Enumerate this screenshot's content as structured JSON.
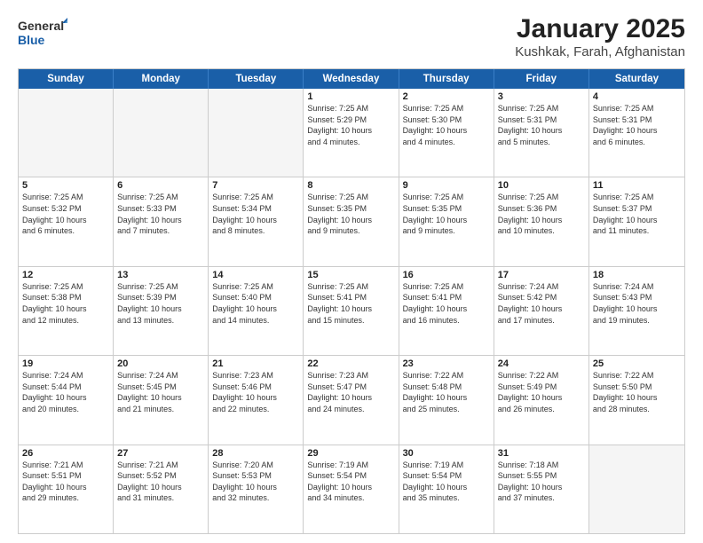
{
  "logo": {
    "general": "General",
    "blue": "Blue"
  },
  "title": "January 2025",
  "subtitle": "Kushkak, Farah, Afghanistan",
  "header_days": [
    "Sunday",
    "Monday",
    "Tuesday",
    "Wednesday",
    "Thursday",
    "Friday",
    "Saturday"
  ],
  "weeks": [
    [
      {
        "day": "",
        "info": "",
        "empty": true
      },
      {
        "day": "",
        "info": "",
        "empty": true
      },
      {
        "day": "",
        "info": "",
        "empty": true
      },
      {
        "day": "1",
        "info": "Sunrise: 7:25 AM\nSunset: 5:29 PM\nDaylight: 10 hours\nand 4 minutes.",
        "empty": false
      },
      {
        "day": "2",
        "info": "Sunrise: 7:25 AM\nSunset: 5:30 PM\nDaylight: 10 hours\nand 4 minutes.",
        "empty": false
      },
      {
        "day": "3",
        "info": "Sunrise: 7:25 AM\nSunset: 5:31 PM\nDaylight: 10 hours\nand 5 minutes.",
        "empty": false
      },
      {
        "day": "4",
        "info": "Sunrise: 7:25 AM\nSunset: 5:31 PM\nDaylight: 10 hours\nand 6 minutes.",
        "empty": false
      }
    ],
    [
      {
        "day": "5",
        "info": "Sunrise: 7:25 AM\nSunset: 5:32 PM\nDaylight: 10 hours\nand 6 minutes.",
        "empty": false
      },
      {
        "day": "6",
        "info": "Sunrise: 7:25 AM\nSunset: 5:33 PM\nDaylight: 10 hours\nand 7 minutes.",
        "empty": false
      },
      {
        "day": "7",
        "info": "Sunrise: 7:25 AM\nSunset: 5:34 PM\nDaylight: 10 hours\nand 8 minutes.",
        "empty": false
      },
      {
        "day": "8",
        "info": "Sunrise: 7:25 AM\nSunset: 5:35 PM\nDaylight: 10 hours\nand 9 minutes.",
        "empty": false
      },
      {
        "day": "9",
        "info": "Sunrise: 7:25 AM\nSunset: 5:35 PM\nDaylight: 10 hours\nand 9 minutes.",
        "empty": false
      },
      {
        "day": "10",
        "info": "Sunrise: 7:25 AM\nSunset: 5:36 PM\nDaylight: 10 hours\nand 10 minutes.",
        "empty": false
      },
      {
        "day": "11",
        "info": "Sunrise: 7:25 AM\nSunset: 5:37 PM\nDaylight: 10 hours\nand 11 minutes.",
        "empty": false
      }
    ],
    [
      {
        "day": "12",
        "info": "Sunrise: 7:25 AM\nSunset: 5:38 PM\nDaylight: 10 hours\nand 12 minutes.",
        "empty": false
      },
      {
        "day": "13",
        "info": "Sunrise: 7:25 AM\nSunset: 5:39 PM\nDaylight: 10 hours\nand 13 minutes.",
        "empty": false
      },
      {
        "day": "14",
        "info": "Sunrise: 7:25 AM\nSunset: 5:40 PM\nDaylight: 10 hours\nand 14 minutes.",
        "empty": false
      },
      {
        "day": "15",
        "info": "Sunrise: 7:25 AM\nSunset: 5:41 PM\nDaylight: 10 hours\nand 15 minutes.",
        "empty": false
      },
      {
        "day": "16",
        "info": "Sunrise: 7:25 AM\nSunset: 5:41 PM\nDaylight: 10 hours\nand 16 minutes.",
        "empty": false
      },
      {
        "day": "17",
        "info": "Sunrise: 7:24 AM\nSunset: 5:42 PM\nDaylight: 10 hours\nand 17 minutes.",
        "empty": false
      },
      {
        "day": "18",
        "info": "Sunrise: 7:24 AM\nSunset: 5:43 PM\nDaylight: 10 hours\nand 19 minutes.",
        "empty": false
      }
    ],
    [
      {
        "day": "19",
        "info": "Sunrise: 7:24 AM\nSunset: 5:44 PM\nDaylight: 10 hours\nand 20 minutes.",
        "empty": false
      },
      {
        "day": "20",
        "info": "Sunrise: 7:24 AM\nSunset: 5:45 PM\nDaylight: 10 hours\nand 21 minutes.",
        "empty": false
      },
      {
        "day": "21",
        "info": "Sunrise: 7:23 AM\nSunset: 5:46 PM\nDaylight: 10 hours\nand 22 minutes.",
        "empty": false
      },
      {
        "day": "22",
        "info": "Sunrise: 7:23 AM\nSunset: 5:47 PM\nDaylight: 10 hours\nand 24 minutes.",
        "empty": false
      },
      {
        "day": "23",
        "info": "Sunrise: 7:22 AM\nSunset: 5:48 PM\nDaylight: 10 hours\nand 25 minutes.",
        "empty": false
      },
      {
        "day": "24",
        "info": "Sunrise: 7:22 AM\nSunset: 5:49 PM\nDaylight: 10 hours\nand 26 minutes.",
        "empty": false
      },
      {
        "day": "25",
        "info": "Sunrise: 7:22 AM\nSunset: 5:50 PM\nDaylight: 10 hours\nand 28 minutes.",
        "empty": false
      }
    ],
    [
      {
        "day": "26",
        "info": "Sunrise: 7:21 AM\nSunset: 5:51 PM\nDaylight: 10 hours\nand 29 minutes.",
        "empty": false
      },
      {
        "day": "27",
        "info": "Sunrise: 7:21 AM\nSunset: 5:52 PM\nDaylight: 10 hours\nand 31 minutes.",
        "empty": false
      },
      {
        "day": "28",
        "info": "Sunrise: 7:20 AM\nSunset: 5:53 PM\nDaylight: 10 hours\nand 32 minutes.",
        "empty": false
      },
      {
        "day": "29",
        "info": "Sunrise: 7:19 AM\nSunset: 5:54 PM\nDaylight: 10 hours\nand 34 minutes.",
        "empty": false
      },
      {
        "day": "30",
        "info": "Sunrise: 7:19 AM\nSunset: 5:54 PM\nDaylight: 10 hours\nand 35 minutes.",
        "empty": false
      },
      {
        "day": "31",
        "info": "Sunrise: 7:18 AM\nSunset: 5:55 PM\nDaylight: 10 hours\nand 37 minutes.",
        "empty": false
      },
      {
        "day": "",
        "info": "",
        "empty": true
      }
    ]
  ]
}
